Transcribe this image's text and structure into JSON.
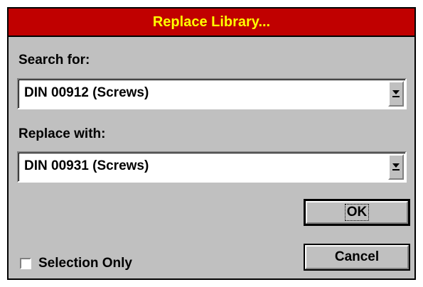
{
  "dialog": {
    "title": "Replace Library..."
  },
  "search": {
    "label": "Search for:",
    "value": "DIN 00912 (Screws)"
  },
  "replace": {
    "label": "Replace with:",
    "value": "DIN 00931 (Screws)"
  },
  "buttons": {
    "ok": "OK",
    "cancel": "Cancel"
  },
  "options": {
    "selection_only_label": "Selection Only",
    "selection_only_checked": false
  },
  "icons": {
    "dropdown": "chevron-down-icon",
    "checkbox": "checkbox-icon"
  },
  "colors": {
    "titlebar": "#c00000",
    "title_text": "#ffff00",
    "dialog_bg": "#c0c0c0"
  }
}
